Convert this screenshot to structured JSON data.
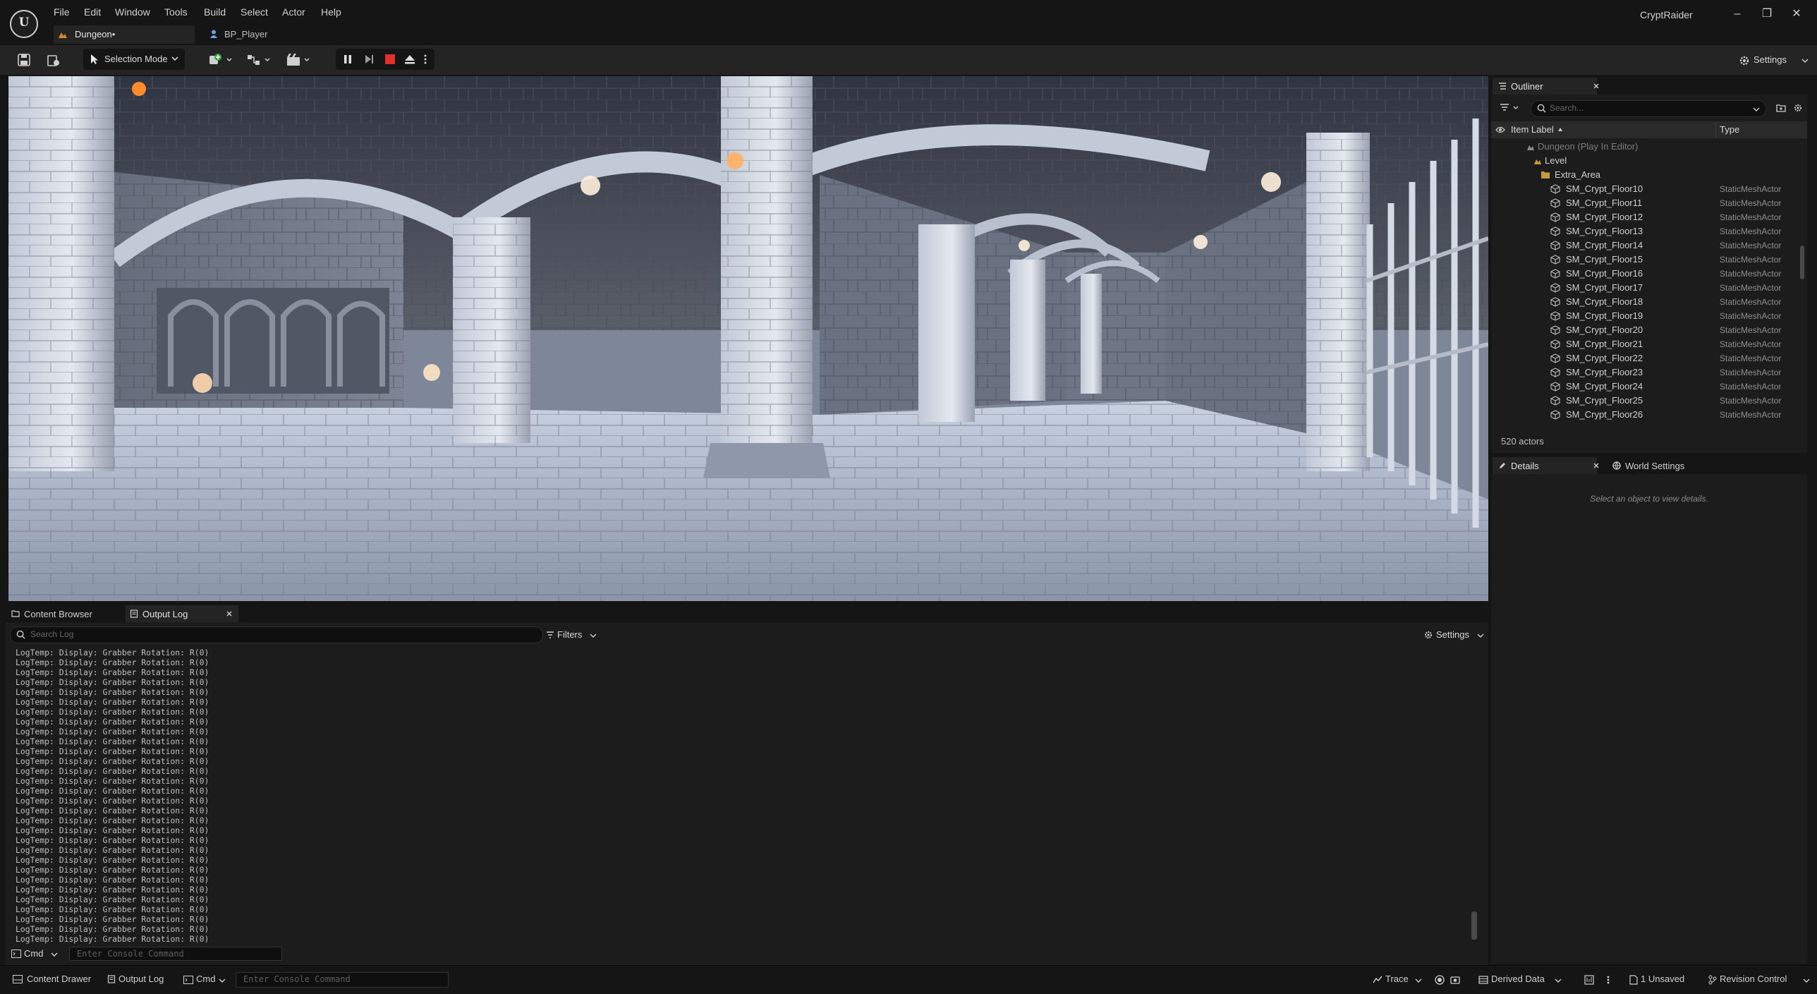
{
  "app": {
    "project_title": "CryptRaider",
    "menu": [
      "File",
      "Edit",
      "Window",
      "Tools",
      "Build",
      "Select",
      "Actor",
      "Help"
    ],
    "doc_tabs": [
      {
        "label": "Dungeon•",
        "active": true
      },
      {
        "label": "BP_Player",
        "active": false
      }
    ]
  },
  "toolbar": {
    "mode_label": "Selection Mode",
    "settings_label": "Settings",
    "play_controls": [
      "pause",
      "step",
      "stop",
      "eject",
      "more"
    ]
  },
  "outliner": {
    "tab_label": "Outliner",
    "search_placeholder": "Search...",
    "col_label": "Item Label",
    "col_type": "Type",
    "tree": [
      {
        "label": "Dungeon (Play In Editor)"
      },
      {
        "label": "Level"
      },
      {
        "label": "Extra_Area"
      }
    ],
    "rows": [
      {
        "name": "SM_Crypt_Floor10",
        "type": "StaticMeshActor"
      },
      {
        "name": "SM_Crypt_Floor11",
        "type": "StaticMeshActor"
      },
      {
        "name": "SM_Crypt_Floor12",
        "type": "StaticMeshActor"
      },
      {
        "name": "SM_Crypt_Floor13",
        "type": "StaticMeshActor"
      },
      {
        "name": "SM_Crypt_Floor14",
        "type": "StaticMeshActor"
      },
      {
        "name": "SM_Crypt_Floor15",
        "type": "StaticMeshActor"
      },
      {
        "name": "SM_Crypt_Floor16",
        "type": "StaticMeshActor"
      },
      {
        "name": "SM_Crypt_Floor17",
        "type": "StaticMeshActor"
      },
      {
        "name": "SM_Crypt_Floor18",
        "type": "StaticMeshActor"
      },
      {
        "name": "SM_Crypt_Floor19",
        "type": "StaticMeshActor"
      },
      {
        "name": "SM_Crypt_Floor20",
        "type": "StaticMeshActor"
      },
      {
        "name": "SM_Crypt_Floor21",
        "type": "StaticMeshActor"
      },
      {
        "name": "SM_Crypt_Floor22",
        "type": "StaticMeshActor"
      },
      {
        "name": "SM_Crypt_Floor23",
        "type": "StaticMeshActor"
      },
      {
        "name": "SM_Crypt_Floor24",
        "type": "StaticMeshActor"
      },
      {
        "name": "SM_Crypt_Floor25",
        "type": "StaticMeshActor"
      },
      {
        "name": "SM_Crypt_Floor26",
        "type": "StaticMeshActor"
      }
    ],
    "actor_count": "520 actors"
  },
  "details": {
    "tab_details": "Details",
    "tab_world": "World Settings",
    "empty_message": "Select an object to view details."
  },
  "log": {
    "tab_content_browser": "Content Browser",
    "tab_output_log": "Output Log",
    "search_placeholder": "Search Log",
    "filters_label": "Filters",
    "settings_label": "Settings",
    "line_text": "LogTemp: Display: Grabber Rotation: R(0)",
    "line_count": 30,
    "cmd_label": "Cmd",
    "console_placeholder": "Enter Console Command"
  },
  "statusbar": {
    "content_drawer": "Content Drawer",
    "output_log": "Output Log",
    "cmd_label": "Cmd",
    "console_placeholder": "Enter Console Command",
    "trace": "Trace",
    "derived_data": "Derived Data",
    "unsaved": "1 Unsaved",
    "revision_control": "Revision Control"
  },
  "colors": {
    "background": "#151515",
    "panel": "#1c1c1c",
    "tab_active": "#242424",
    "stop_red": "#e0312b",
    "folder": "#c79a3b"
  }
}
